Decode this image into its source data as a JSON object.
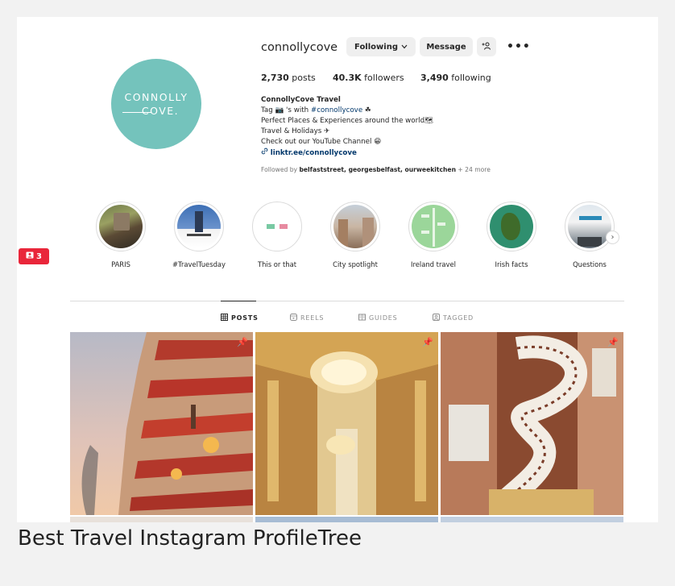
{
  "profile": {
    "username": "connollycove",
    "avatar_text": {
      "line1": "CONNOLLY",
      "line2": "COVE."
    },
    "buttons": {
      "following": "Following",
      "message": "Message"
    },
    "stats": {
      "posts_count": "2,730",
      "posts_label": "posts",
      "followers_count": "40.3K",
      "followers_label": "followers",
      "following_count": "3,490",
      "following_label": "following"
    },
    "bio": {
      "name": "ConnollyCove Travel",
      "line1_prefix": "Tag 📷 's with ",
      "line1_tag": "#connollycove",
      "line1_suffix": " ☘",
      "line2": "Perfect Places & Experiences around the world🗺",
      "line3": "Travel & Holidays ✈",
      "line4": "Check out our YouTube Channel 😁",
      "link": "linktr.ee/connollycove"
    },
    "followed_by": {
      "prefix": "Followed by ",
      "names": "belfaststreet, georgesbelfast, ourweekitchen",
      "more": " + 24 more"
    }
  },
  "highlights": [
    {
      "label": "PARIS"
    },
    {
      "label": "#TravelTuesday"
    },
    {
      "label": "This or that"
    },
    {
      "label": "City spotlight"
    },
    {
      "label": "Ireland travel"
    },
    {
      "label": "Irish facts"
    },
    {
      "label": "Questions"
    }
  ],
  "tabs": [
    {
      "label": "POSTS",
      "active": true
    },
    {
      "label": "REELS",
      "active": false
    },
    {
      "label": "GUIDES",
      "active": false
    },
    {
      "label": "TAGGED",
      "active": false
    }
  ],
  "badge": {
    "count": "3"
  },
  "caption": "Best Travel Instagram ProfileTree",
  "colors": {
    "avatar": "#74c3bc",
    "badge": "#e9263a",
    "link": "#00376b"
  }
}
